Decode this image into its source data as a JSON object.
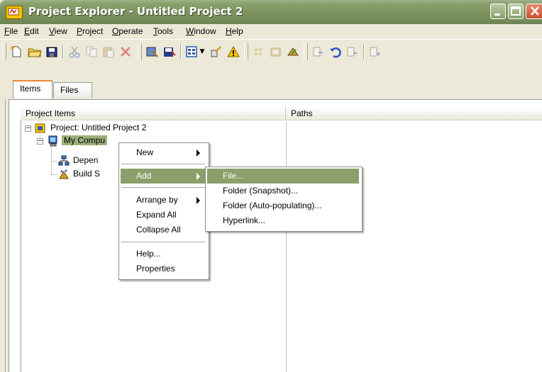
{
  "window": {
    "title": "Project Explorer - Untitled Project 2"
  },
  "menubar": [
    {
      "label": "File",
      "u": "F",
      "rest": "ile"
    },
    {
      "label": "Edit",
      "u": "E",
      "rest": "dit"
    },
    {
      "label": "View",
      "u": "V",
      "rest": "iew"
    },
    {
      "label": "Project",
      "u": "P",
      "rest": "roject"
    },
    {
      "label": "Operate",
      "u": "O",
      "rest": "perate"
    },
    {
      "label": "Tools",
      "u": "T",
      "rest": "ools"
    },
    {
      "label": "Window",
      "u": "W",
      "rest": "indow"
    },
    {
      "label": "Help",
      "u": "H",
      "rest": "elp"
    }
  ],
  "tabs": {
    "items": "Items",
    "files": "Files"
  },
  "columns": {
    "project_items": "Project Items",
    "paths": "Paths"
  },
  "tree": {
    "project": "Project: Untitled Project 2",
    "my_computer": "My Compu",
    "dependencies": "Depen",
    "build_specs": "Build S"
  },
  "context_menu": {
    "new": "New",
    "add": "Add",
    "arrange_by": "Arrange by",
    "expand_all": "Expand All",
    "collapse_all": "Collapse All",
    "help": "Help...",
    "properties": "Properties"
  },
  "add_submenu": {
    "file": "File...",
    "folder_snapshot": "Folder (Snapshot)...",
    "folder_auto": "Folder (Auto-populating)...",
    "hyperlink": "Hyperlink..."
  },
  "colors": {
    "titlebar": "#7c9360",
    "highlight": "#8b9f6a",
    "selection": "#9cb17a"
  }
}
